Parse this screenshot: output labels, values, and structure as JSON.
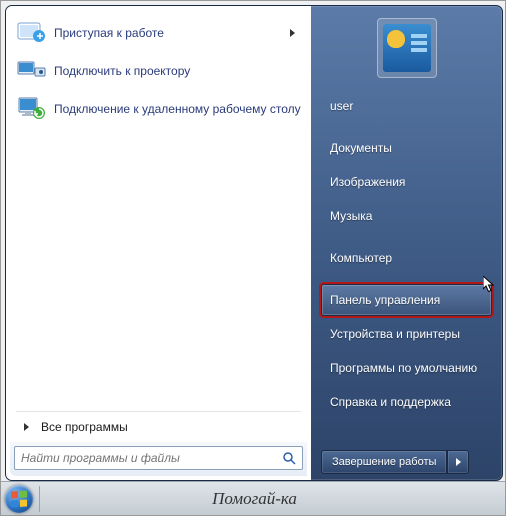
{
  "programs": [
    {
      "label": "Приступая к работе",
      "has_submenu": true,
      "icon": "getting-started-icon"
    },
    {
      "label": "Подключить к проектору",
      "has_submenu": false,
      "icon": "projector-icon"
    },
    {
      "label": "Подключение к удаленному рабочему столу",
      "has_submenu": false,
      "icon": "remote-desktop-icon"
    }
  ],
  "all_programs_label": "Все программы",
  "search": {
    "placeholder": "Найти программы и файлы"
  },
  "sidebar": {
    "items": [
      {
        "label": "user",
        "sep_after": true
      },
      {
        "label": "Документы"
      },
      {
        "label": "Изображения"
      },
      {
        "label": "Музыка",
        "sep_after": true
      },
      {
        "label": "Компьютер",
        "sep_after": true
      },
      {
        "label": "Панель управления",
        "highlighted": true
      },
      {
        "label": "Устройства и принтеры"
      },
      {
        "label": "Программы по умолчанию"
      },
      {
        "label": "Справка и поддержка"
      }
    ]
  },
  "shutdown_label": "Завершение работы",
  "taskbar": {
    "helper": "Помогай-ка"
  }
}
